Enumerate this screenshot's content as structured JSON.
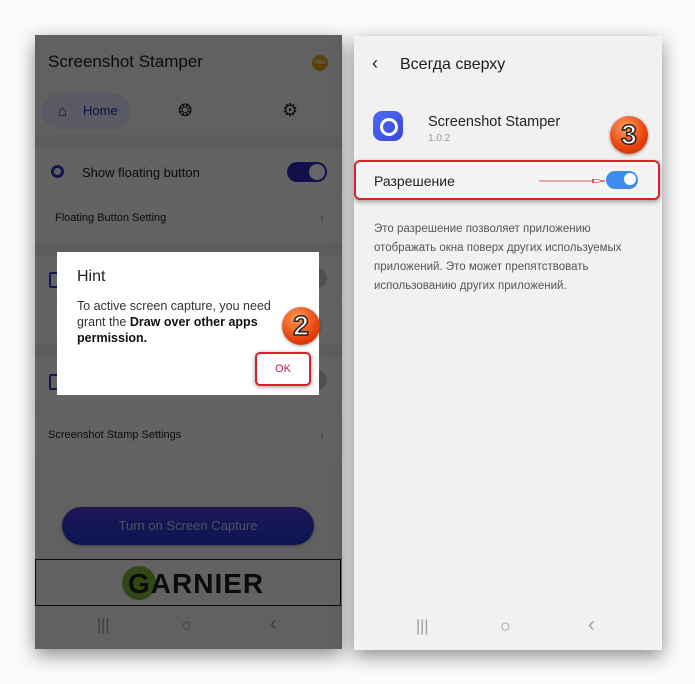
{
  "left_screen": {
    "app_title": "Screenshot Stamper",
    "pro_badge": "PRO",
    "tabs": [
      {
        "label": "Home",
        "icon": "home-icon",
        "active": true
      },
      {
        "label": "",
        "icon": "shutter-icon",
        "active": false
      },
      {
        "label": "",
        "icon": "gear-icon",
        "active": false
      }
    ],
    "rows": {
      "show_floating": {
        "label": "Show floating button",
        "toggle_on": true
      },
      "floating_setting": {
        "label": "Floating Button Setting",
        "chevron": "›"
      },
      "stamp_settings": {
        "label": "Screenshot Stamp Settings",
        "chevron": "›"
      }
    },
    "capture_button": "Turn on Screen Capture",
    "ad_brand": "GARNIER",
    "navbar": {
      "recents": "|||",
      "home": "○",
      "back": "‹"
    },
    "dialog": {
      "title": "Hint",
      "body_prefix": "To active screen capture, you need grant the ",
      "body_bold": "Draw over other apps permission.",
      "ok": "OK"
    },
    "step_marker": "2"
  },
  "right_screen": {
    "back": "‹",
    "title": "Всегда сверху",
    "app_name": "Screenshot Stamper",
    "app_version": "1.0.2",
    "permission_label": "Разрешение",
    "permission_on": true,
    "description": "Это разрешение позволяет приложению отображать окна поверх других используемых приложений. Это может препятствовать использованию других приложений.",
    "navbar": {
      "recents": "|||",
      "home": "○",
      "back": "‹"
    },
    "step_marker": "3"
  },
  "colors": {
    "accent_left": "#1b2aa8",
    "toggle_right": "#3d8cf0",
    "highlight_red": "#d8222a",
    "marker_orange": "#e8420c"
  }
}
